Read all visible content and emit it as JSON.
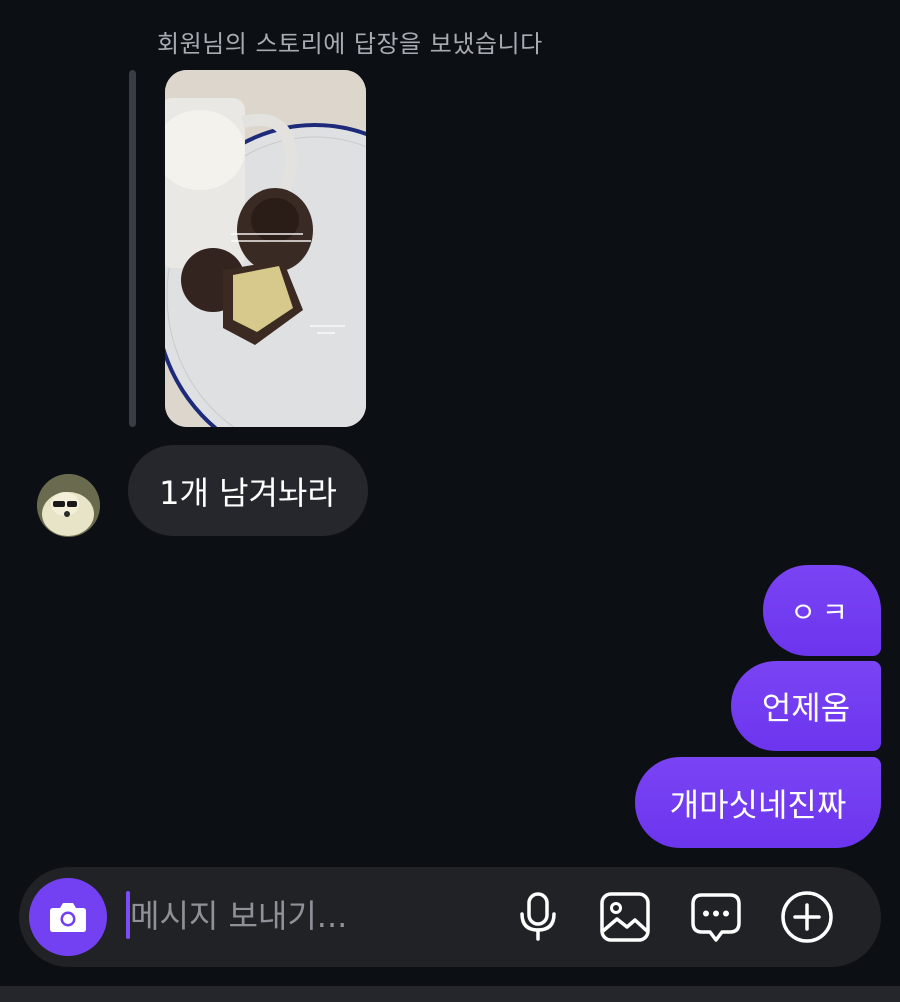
{
  "story_reply": {
    "caption": "회원님의 스토리에 답장을 보냈습니다"
  },
  "messages": {
    "incoming": [
      {
        "text": "1개 남겨놔라"
      }
    ],
    "outgoing": [
      {
        "text": "ㅇㅋ"
      },
      {
        "text": "언제옴"
      },
      {
        "text": "개마싯네진짜"
      }
    ]
  },
  "composer": {
    "placeholder": "메시지 보내기..."
  },
  "icons": {
    "camera": "camera-icon",
    "mic": "microphone-icon",
    "gallery": "image-icon",
    "sticker": "chat-bubble-dots-icon",
    "plus": "plus-circle-icon"
  },
  "colors": {
    "background": "#0c0f14",
    "incoming_bubble": "#25272d",
    "outgoing_bubble": "#7441f2",
    "composer": "#202226"
  }
}
